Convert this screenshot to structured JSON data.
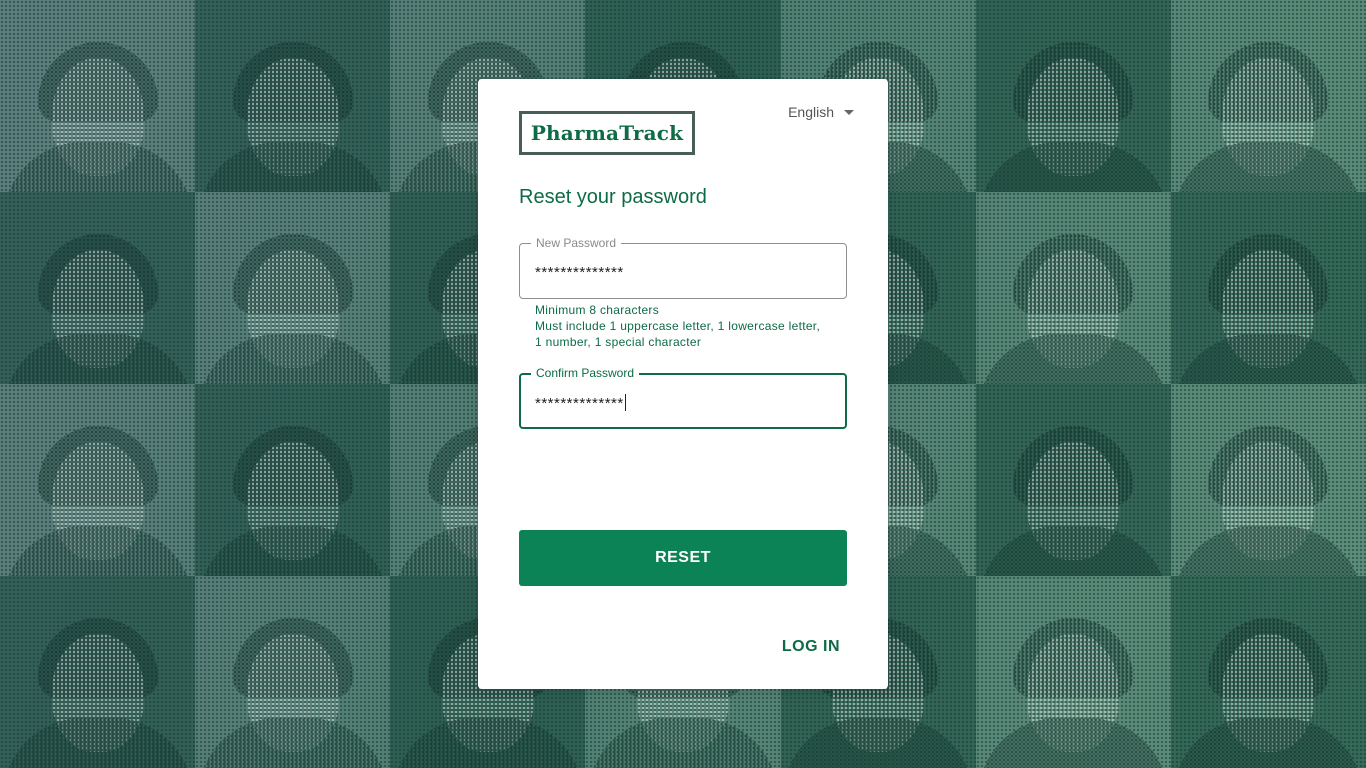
{
  "app": {
    "logo_text": "PharmaTrack",
    "accent_color": "#0d6b45",
    "button_color": "#0c8257"
  },
  "language_selector": {
    "selected": "English",
    "icon": "chevron-down-icon"
  },
  "form": {
    "title": "Reset your password",
    "new_password": {
      "label": "New Password",
      "value": "**************"
    },
    "hints": [
      "Minimum 8 characters",
      "Must include 1 uppercase letter, 1 lowercase letter,",
      "1 number, 1 special character"
    ],
    "confirm_password": {
      "label": "Confirm Password",
      "value": "**************"
    },
    "reset_label": "RESET",
    "login_label": "LOG IN"
  }
}
